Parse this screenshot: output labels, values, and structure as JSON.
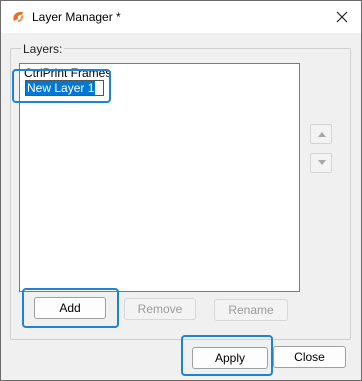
{
  "window": {
    "title": "Layer Manager *"
  },
  "layers": {
    "group_label": "Layers:",
    "items": [
      {
        "label": "CtrlPrint Frames",
        "state": "normal"
      },
      {
        "label": "New Layer 1",
        "state": "editing"
      }
    ]
  },
  "buttons": {
    "add": "Add",
    "remove": "Remove",
    "rename": "Rename",
    "apply": "Apply",
    "close": "Close"
  },
  "colors": {
    "accent": "#1e82d6",
    "selection": "#0078d7",
    "app_icon": "#e8702a"
  },
  "icons": [
    "app-icon",
    "close-icon",
    "up-arrow-icon",
    "down-arrow-icon"
  ]
}
